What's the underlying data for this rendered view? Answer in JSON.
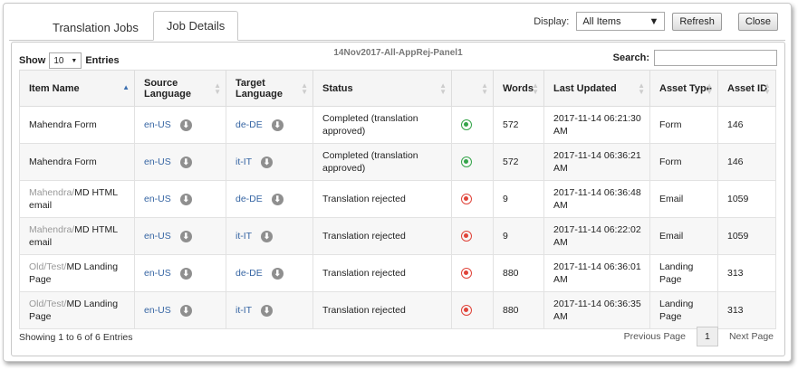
{
  "tabs": [
    {
      "label": "Translation Jobs"
    },
    {
      "label": "Job Details"
    }
  ],
  "display": {
    "label": "Display:",
    "selected": "All Items",
    "refresh_label": "Refresh",
    "close_label": "Close"
  },
  "toolbar": {
    "show_label": "Show",
    "entries_value": "10",
    "entries_label": "Entries",
    "job_name": "14Nov2017-All-AppRej-Panel1",
    "search_label": "Search:",
    "search_value": ""
  },
  "columns": {
    "item_name": "Item Name",
    "source_language_1": "Source",
    "source_language_2": "Language",
    "target_language_1": "Target",
    "target_language_2": "Language",
    "status": "Status",
    "words": "Words",
    "last_updated": "Last Updated",
    "asset_type": "Asset Type",
    "asset_id": "Asset ID"
  },
  "rows": [
    {
      "prefix": "",
      "name": "Mahendra Form",
      "source": "en-US",
      "target": "de-DE",
      "status_1": "Completed (translation",
      "status_2": "approved)",
      "status_icon": "approved-icon",
      "words": "572",
      "updated_1": "2017-11-14 06:21:30",
      "updated_2": "AM",
      "type_1": "Form",
      "type_2": "",
      "id": "146"
    },
    {
      "prefix": "",
      "name": "Mahendra Form",
      "source": "en-US",
      "target": "it-IT",
      "status_1": "Completed (translation",
      "status_2": "approved)",
      "status_icon": "approved-icon",
      "words": "572",
      "updated_1": "2017-11-14 06:36:21",
      "updated_2": "AM",
      "type_1": "Form",
      "type_2": "",
      "id": "146"
    },
    {
      "prefix": "Mahendra/",
      "name": "MD HTML",
      "name_2": "email",
      "source": "en-US",
      "target": "de-DE",
      "status_1": "Translation rejected",
      "status_2": "",
      "status_icon": "rejected-icon",
      "words": "9",
      "updated_1": "2017-11-14 06:36:48",
      "updated_2": "AM",
      "type_1": "Email",
      "type_2": "",
      "id": "1059"
    },
    {
      "prefix": "Mahendra/",
      "name": "MD HTML",
      "name_2": "email",
      "source": "en-US",
      "target": "it-IT",
      "status_1": "Translation rejected",
      "status_2": "",
      "status_icon": "rejected-icon",
      "words": "9",
      "updated_1": "2017-11-14 06:22:02",
      "updated_2": "AM",
      "type_1": "Email",
      "type_2": "",
      "id": "1059"
    },
    {
      "prefix": "Old/Test/",
      "name": "MD Landing",
      "name_2": "Page",
      "source": "en-US",
      "target": "de-DE",
      "status_1": "Translation rejected",
      "status_2": "",
      "status_icon": "rejected-icon",
      "words": "880",
      "updated_1": "2017-11-14 06:36:01",
      "updated_2": "AM",
      "type_1": "Landing",
      "type_2": "Page",
      "id": "313"
    },
    {
      "prefix": "Old/Test/",
      "name": "MD Landing",
      "name_2": "Page",
      "source": "en-US",
      "target": "it-IT",
      "status_1": "Translation rejected",
      "status_2": "",
      "status_icon": "rejected-icon",
      "words": "880",
      "updated_1": "2017-11-14 06:36:35",
      "updated_2": "AM",
      "type_1": "Landing",
      "type_2": "Page",
      "id": "313"
    }
  ],
  "footer": {
    "info": "Showing 1 to 6 of 6 Entries",
    "prev_label": "Previous Page",
    "page_number": "1",
    "next_label": "Next Page"
  },
  "colors": {
    "link": "#3665a3",
    "approved": "#35a44a",
    "rejected": "#e0443a"
  }
}
